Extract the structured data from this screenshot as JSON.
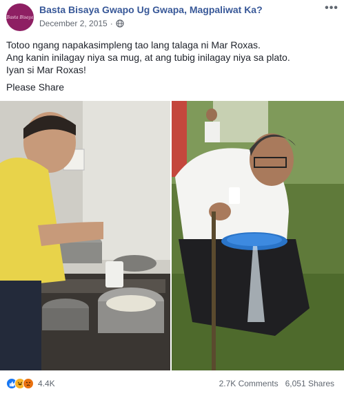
{
  "post": {
    "page_name": "Basta Bisaya Gwapo Ug Gwapa, Magpaliwat Ka?",
    "avatar_text": "Basta Bisaya",
    "date": "December 2, 2015",
    "separator": "·",
    "privacy_icon": "globe-icon",
    "more_icon": "more-options-icon",
    "text_lines": [
      "Totoo ngang napakasimpleng tao lang talaga ni Mar Roxas.",
      "Ang kanin inilagay niya sa mug, at ang tubig inilagay niya sa plato.",
      "Iyan si Mar Roxas!"
    ],
    "share_text": "Please Share",
    "photos": [
      {
        "description_icon": "photo-cooking-rice"
      },
      {
        "description_icon": "photo-water-plate"
      }
    ]
  },
  "footer": {
    "reactions": [
      "like-icon",
      "haha-icon",
      "angry-icon"
    ],
    "reaction_count": "4.4K",
    "comments": "2.7K Comments",
    "shares": "6,051 Shares"
  },
  "colors": {
    "link_blue": "#385898",
    "text": "#1d2129",
    "meta": "#616770",
    "like": "#1877f2",
    "haha": "#f7b125",
    "angry": "#e9710f"
  }
}
